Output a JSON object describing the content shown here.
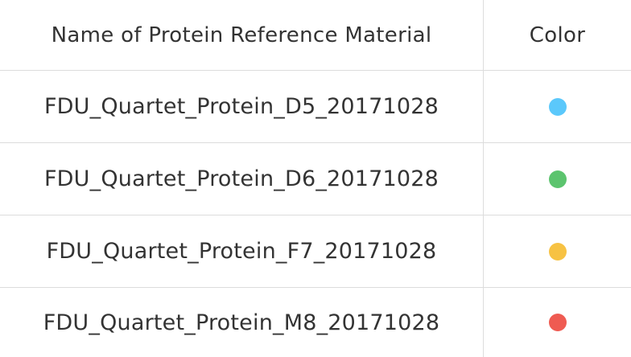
{
  "header": {
    "name_column": "Name of Protein Reference Material",
    "color_column": "Color"
  },
  "rows": [
    {
      "name": "FDU_Quartet_Protein_D5_20171028",
      "color": "#5bc8fb",
      "color_icon": "light-blue-dot-icon"
    },
    {
      "name": "FDU_Quartet_Protein_D6_20171028",
      "color": "#5cc46e",
      "color_icon": "green-dot-icon"
    },
    {
      "name": "FDU_Quartet_Protein_F7_20171028",
      "color": "#f7c243",
      "color_icon": "yellow-dot-icon"
    },
    {
      "name": "FDU_Quartet_Protein_M8_20171028",
      "color": "#ef5b52",
      "color_icon": "red-dot-icon"
    }
  ]
}
